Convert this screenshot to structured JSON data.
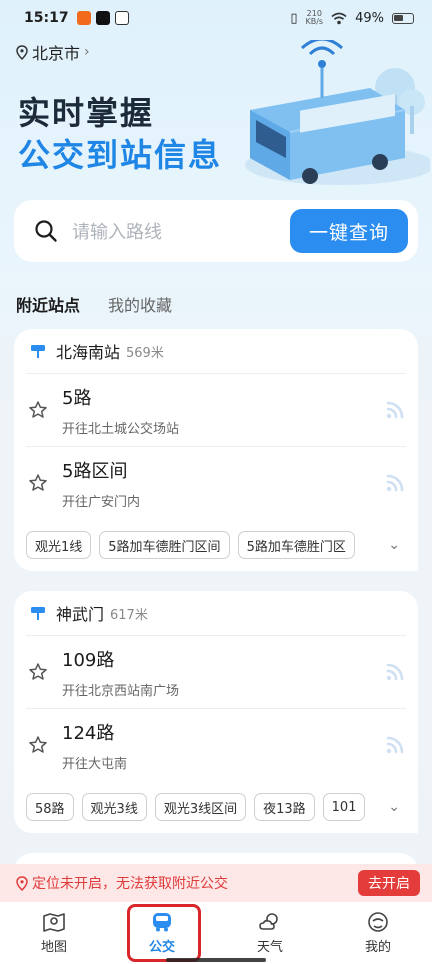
{
  "status": {
    "time": "15:17",
    "net_speed_top": "210",
    "net_speed_bottom": "KB/s",
    "battery": "49%"
  },
  "header": {
    "city": "北京市",
    "title_line1": "实时掌握",
    "title_line2": "公交到站信息"
  },
  "search": {
    "placeholder": "请输入路线",
    "button": "一键查询"
  },
  "tabs": {
    "nearby": "附近站点",
    "favorites": "我的收藏"
  },
  "stops": [
    {
      "name": "北海南站",
      "distance": "569米",
      "routes": [
        {
          "name": "5路",
          "dest": "开往北土城公交场站"
        },
        {
          "name": "5路区间",
          "dest": "开往广安门内"
        }
      ],
      "chips": [
        "观光1线",
        "5路加车德胜门区间",
        "5路加车德胜门区"
      ]
    },
    {
      "name": "神武门",
      "distance": "617米",
      "routes": [
        {
          "name": "109路",
          "dest": "开往北京西站南广场"
        },
        {
          "name": "124路",
          "dest": "开往大屯南"
        }
      ],
      "chips": [
        "58路",
        "观光3线",
        "观光3线区间",
        "夜13路",
        "101"
      ]
    }
  ],
  "banner": {
    "message": "定位未开启，无法获取附近公交",
    "button": "去开启"
  },
  "tabbar": {
    "map": "地图",
    "bus": "公交",
    "weather": "天气",
    "mine": "我的"
  },
  "colors": {
    "accent": "#2b8df0",
    "warning": "#e43b3b",
    "highlight_box": "#d9262b"
  }
}
